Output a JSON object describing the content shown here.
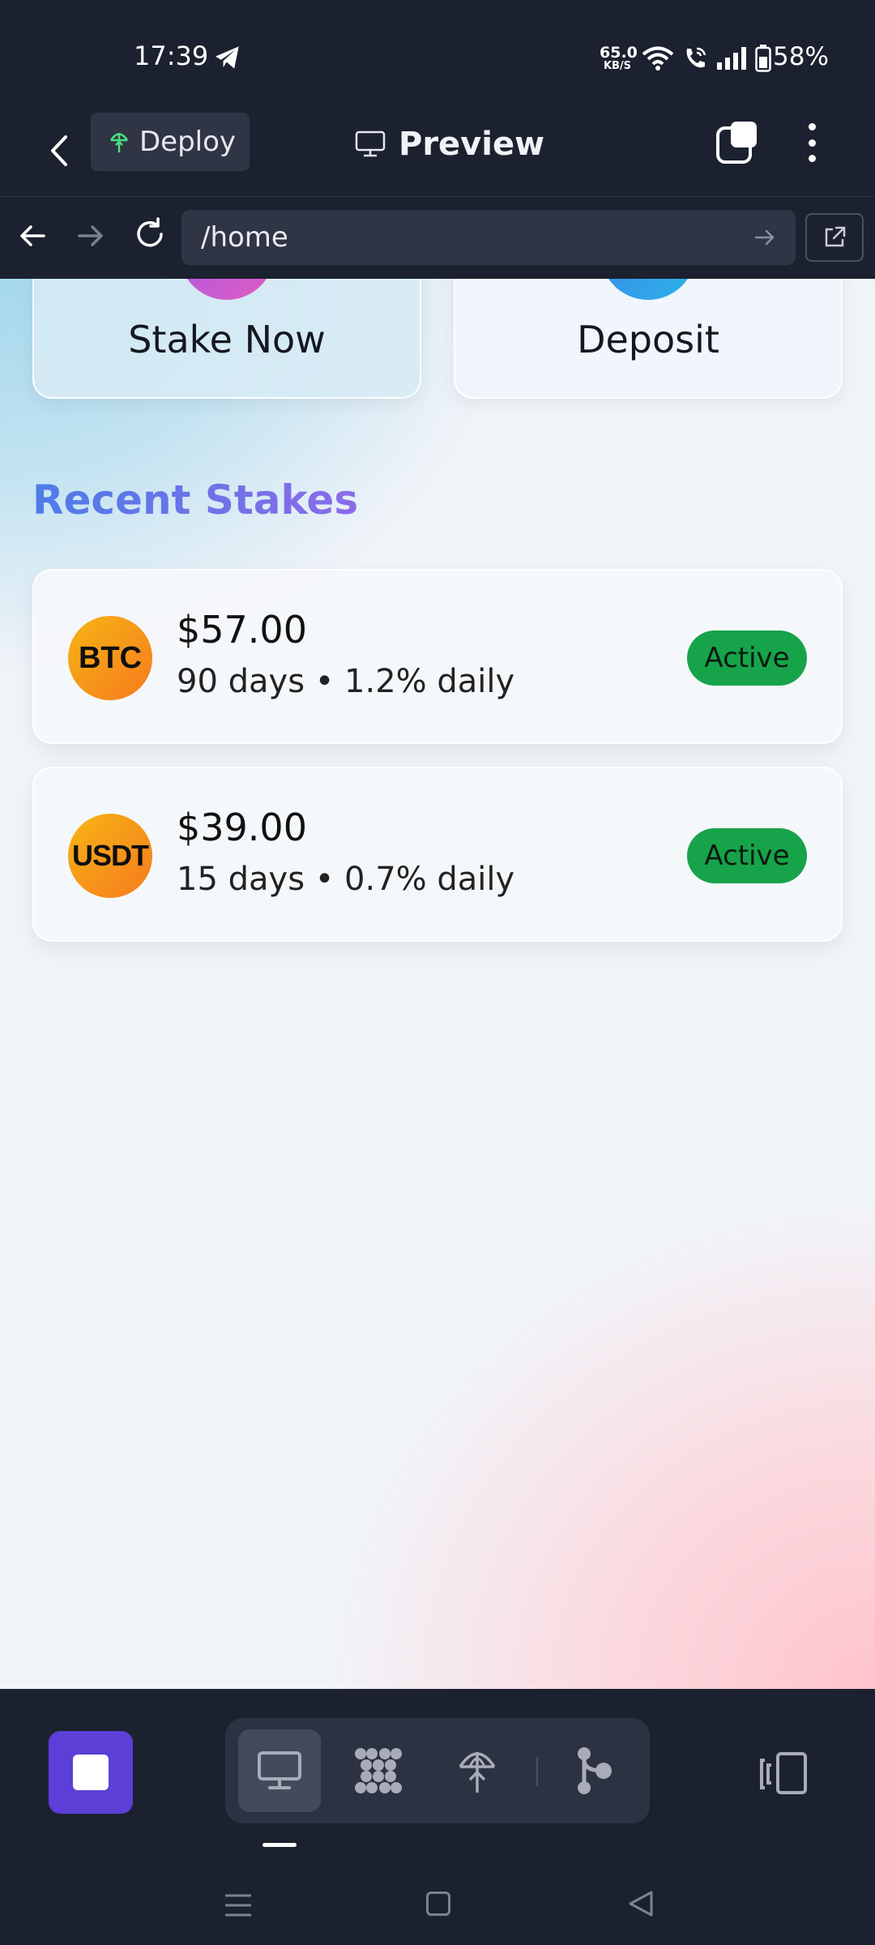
{
  "status_bar": {
    "time": "17:39",
    "net_speed_value": "65.0",
    "net_speed_unit": "KB/S",
    "battery": "58%"
  },
  "header": {
    "deploy_label": "Deploy",
    "title": "Preview"
  },
  "browser": {
    "url": "/home"
  },
  "actions": {
    "stake_label": "Stake Now",
    "deposit_label": "Deposit"
  },
  "recent": {
    "title": "Recent Stakes",
    "stakes": [
      {
        "coin": "BTC",
        "amount": "$57.00",
        "detail": "90 days • 1.2% daily",
        "status": "Active"
      },
      {
        "coin": "USDT",
        "amount": "$39.00",
        "detail": "15 days • 0.7% daily",
        "status": "Active"
      }
    ]
  },
  "colors": {
    "app_bg": "#1c2130",
    "accent_purple": "#5b3fd6",
    "active_green": "#17a34a",
    "coin_orange": "#f59e0b"
  },
  "icons": {
    "status": [
      "telegram-icon",
      "wifi-icon",
      "wifi-call-icon",
      "signal-icon",
      "battery-icon"
    ],
    "toolbar": [
      "stop-icon",
      "desktop-icon",
      "grid-dots-icon",
      "deploy-icon",
      "branch-icon",
      "device-toggle-icon"
    ]
  }
}
